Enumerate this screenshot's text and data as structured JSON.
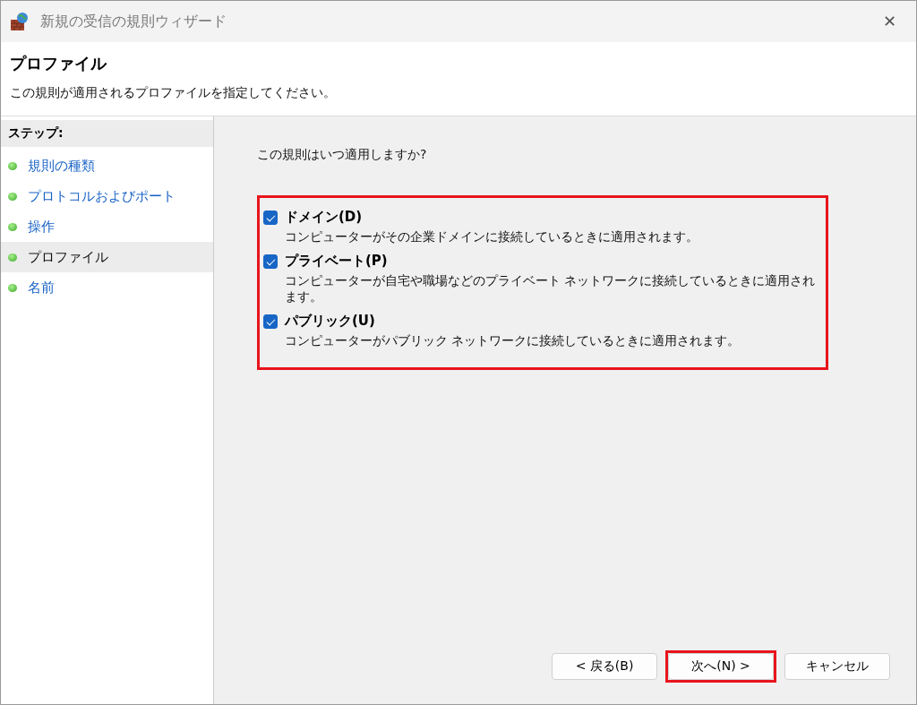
{
  "window": {
    "title": "新規の受信の規則ウィザード",
    "close": "✕"
  },
  "header": {
    "title": "プロファイル",
    "description": "この規則が適用されるプロファイルを指定してください。"
  },
  "sidebar": {
    "heading": "ステップ:",
    "items": [
      {
        "label": "規則の種類",
        "selected": false
      },
      {
        "label": "プロトコルおよびポート",
        "selected": false
      },
      {
        "label": "操作",
        "selected": false
      },
      {
        "label": "プロファイル",
        "selected": true
      },
      {
        "label": "名前",
        "selected": false
      }
    ]
  },
  "content": {
    "question": "この規則はいつ適用しますか?",
    "highlighted": true,
    "profiles": [
      {
        "label": "ドメイン(D)",
        "checked": true,
        "description": "コンピューターがその企業ドメインに接続しているときに適用されます。"
      },
      {
        "label": "プライベート(P)",
        "checked": true,
        "description": "コンピューターが自宅や職場などのプライベート ネットワークに接続しているときに適用されます。"
      },
      {
        "label": "パブリック(U)",
        "checked": true,
        "description": "コンピューターがパブリック ネットワークに接続しているときに適用されます。"
      }
    ]
  },
  "buttons": [
    {
      "label": "< 戻る(B)",
      "highlighted": false
    },
    {
      "label": "次へ(N) >",
      "highlighted": true
    },
    {
      "label": "キャンセル",
      "highlighted": false
    }
  ]
}
